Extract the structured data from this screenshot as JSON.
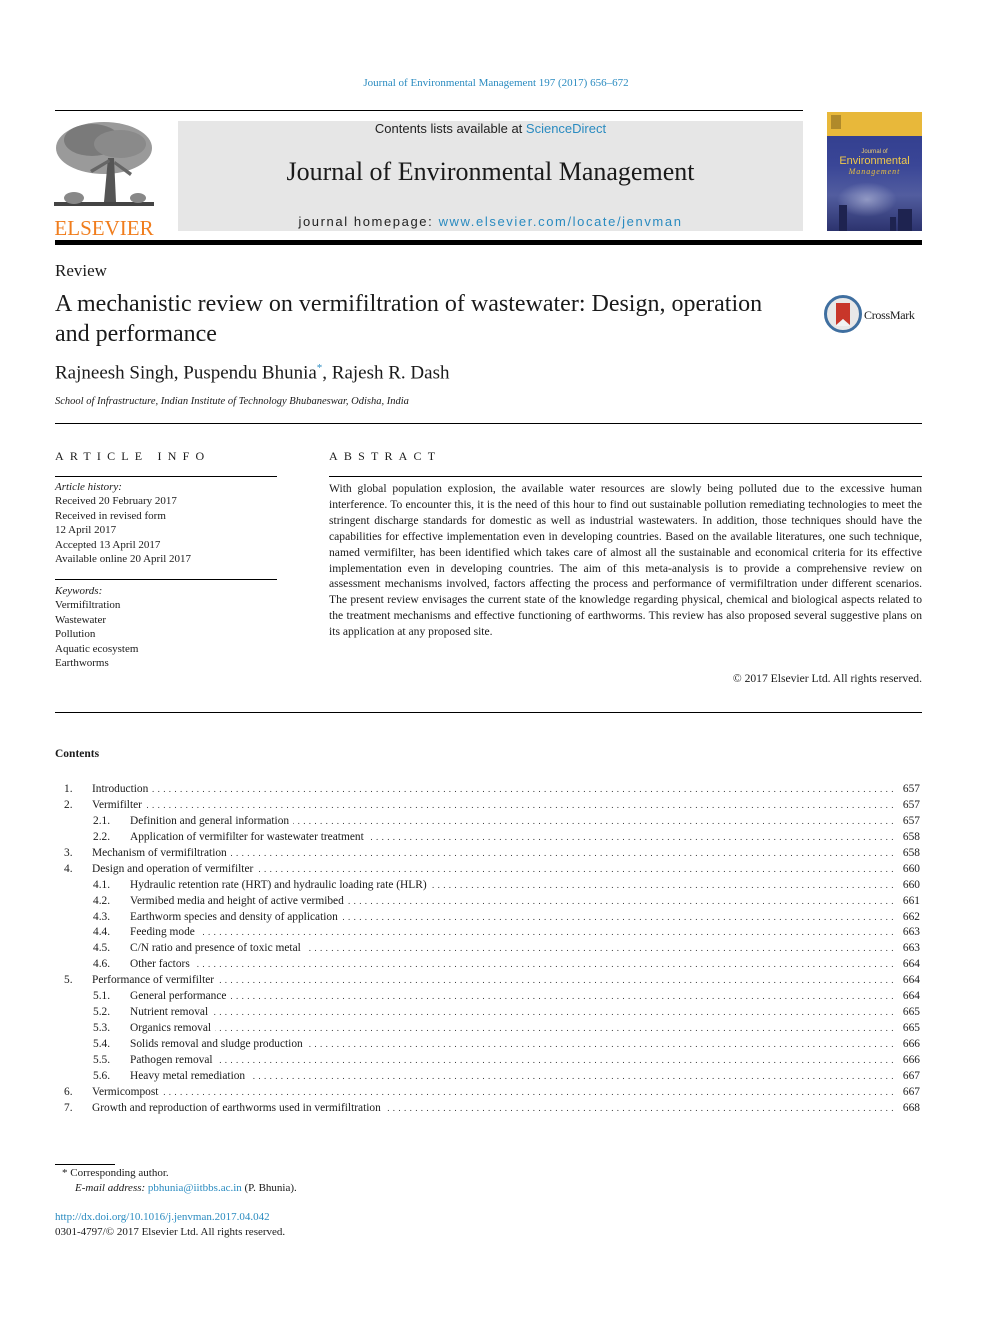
{
  "citation": "Journal of Environmental Management 197 (2017) 656–672",
  "masthead": {
    "available_prefix": "Contents lists available at ",
    "available_link": "ScienceDirect",
    "journal_title": "Journal of Environmental Management",
    "homepage_prefix": "journal homepage: ",
    "homepage_link": "www.elsevier.com/locate/jenvman"
  },
  "publisher_logo": {
    "wordmark": "ELSEVIER",
    "icon": "elsevier-tree-icon",
    "color": "#f07d1d"
  },
  "cover": {
    "small": "Journal of",
    "big": "Environmental",
    "mgmt": "Management"
  },
  "article": {
    "type": "Review",
    "title": "A mechanistic review on vermifiltration of wastewater: Design, operation and performance",
    "crossmark_label": "CrossMark",
    "authors": [
      {
        "name": "Rajneesh Singh",
        "sep": ", "
      },
      {
        "name": "Puspendu Bhunia",
        "mark": "*",
        "sep": ", "
      },
      {
        "name": "Rajesh R. Dash",
        "sep": ""
      }
    ],
    "affiliation": "School of Infrastructure, Indian Institute of Technology Bhubaneswar, Odisha, India"
  },
  "article_info": {
    "heading": "ARTICLE INFO",
    "history_label": "Article history:",
    "history": [
      "Received 20 February 2017",
      "Received in revised form",
      "12 April 2017",
      "Accepted 13 April 2017",
      "Available online 20 April 2017"
    ],
    "keywords_label": "Keywords:",
    "keywords": [
      "Vermifiltration",
      "Wastewater",
      "Pollution",
      "Aquatic ecosystem",
      "Earthworms"
    ]
  },
  "abstract": {
    "heading": "ABSTRACT",
    "text": "With global population explosion, the available water resources are slowly being polluted due to the excessive human interference. To encounter this, it is the need of this hour to find out sustainable pollution remediating technologies to meet the stringent discharge standards for domestic as well as industrial wastewaters. In addition, those techniques should have the capabilities for effective imple­mentation even in developing countries. Based on the available literatures, one such technique, named vermifilter, has been identified which takes care of almost all the sustainable and economical criteria for its effective implementation even in developing countries. The aim of this meta-analysis is to provide a comprehensive review on assessment mechanisms involved, factors affecting the process and perfor­mance of vermifiltration under different scenarios. The present review envisages the current state of the knowledge regarding physical, chemical and biological aspects related to the treatment mechanisms and effective functioning of earthworms. This review has also proposed several suggestive plans on its application at any proposed site.",
    "copyright": "© 2017 Elsevier Ltd. All rights reserved."
  },
  "contents": {
    "heading": "Contents",
    "items": [
      {
        "num": "1.",
        "title": "Introduction",
        "page": "657",
        "level": 1
      },
      {
        "num": "2.",
        "title": "Vermifilter",
        "page": "657",
        "level": 1
      },
      {
        "num": "2.1.",
        "title": "Definition and general information",
        "page": "657",
        "level": 2
      },
      {
        "num": "2.2.",
        "title": "Application of vermifilter for wastewater treatment",
        "page": "658",
        "level": 2
      },
      {
        "num": "3.",
        "title": "Mechanism of vermifiltration",
        "page": "658",
        "level": 1
      },
      {
        "num": "4.",
        "title": "Design and operation of vermifilter",
        "page": "660",
        "level": 1
      },
      {
        "num": "4.1.",
        "title": "Hydraulic retention rate (HRT) and hydraulic loading rate (HLR)",
        "page": "660",
        "level": 2
      },
      {
        "num": "4.2.",
        "title": "Vermibed media and height of active vermibed",
        "page": "661",
        "level": 2
      },
      {
        "num": "4.3.",
        "title": "Earthworm species and density of application",
        "page": "662",
        "level": 2
      },
      {
        "num": "4.4.",
        "title": "Feeding mode",
        "page": "663",
        "level": 2
      },
      {
        "num": "4.5.",
        "title": "C/N ratio and presence of toxic metal",
        "page": "663",
        "level": 2
      },
      {
        "num": "4.6.",
        "title": "Other factors",
        "page": "664",
        "level": 2
      },
      {
        "num": "5.",
        "title": "Performance of vermifilter",
        "page": "664",
        "level": 1
      },
      {
        "num": "5.1.",
        "title": "General performance",
        "page": "664",
        "level": 2
      },
      {
        "num": "5.2.",
        "title": "Nutrient removal",
        "page": "665",
        "level": 2
      },
      {
        "num": "5.3.",
        "title": "Organics removal",
        "page": "665",
        "level": 2
      },
      {
        "num": "5.4.",
        "title": "Solids removal and sludge production",
        "page": "666",
        "level": 2
      },
      {
        "num": "5.5.",
        "title": "Pathogen removal",
        "page": "666",
        "level": 2
      },
      {
        "num": "5.6.",
        "title": "Heavy metal remediation",
        "page": "667",
        "level": 2
      },
      {
        "num": "6.",
        "title": "Vermicompost",
        "page": "667",
        "level": 1
      },
      {
        "num": "7.",
        "title": "Growth and reproduction of earthworms used in vermifiltration",
        "page": "668",
        "level": 1
      }
    ]
  },
  "footnotes": {
    "corresponding": "* Corresponding author.",
    "email_label": "E-mail address: ",
    "email": "pbhunia@iitbbs.ac.in",
    "email_suffix": " (P. Bhunia).",
    "doi": "http://dx.doi.org/10.1016/j.jenvman.2017.04.042",
    "issn": "0301-4797/© 2017 Elsevier Ltd. All rights reserved."
  },
  "colors": {
    "link": "#2a8bc0",
    "elsevier_orange": "#f07d1d",
    "masthead_bg": "#e6e6e6"
  }
}
